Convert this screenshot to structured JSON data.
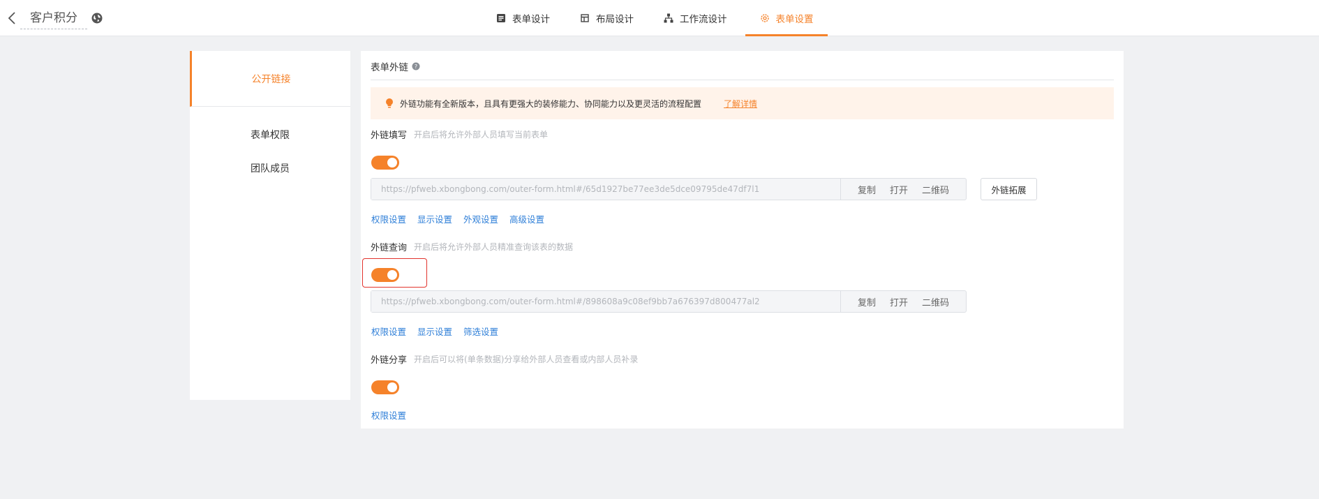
{
  "header": {
    "app_title": "客户积分",
    "tabs": [
      {
        "label": "表单设计",
        "icon": "form-icon",
        "active": false
      },
      {
        "label": "布局设计",
        "icon": "layout-icon",
        "active": false
      },
      {
        "label": "工作流设计",
        "icon": "workflow-icon",
        "active": false
      },
      {
        "label": "表单设置",
        "icon": "gear-icon",
        "active": true
      }
    ]
  },
  "sidebar": {
    "items": [
      {
        "label": "公开链接",
        "active": true
      },
      {
        "label": "表单权限",
        "active": false
      },
      {
        "label": "团队成员",
        "active": false
      }
    ]
  },
  "main": {
    "section_title": "表单外链",
    "notice": {
      "text": "外链功能有全新版本，且具有更强大的装修能力、协同能力以及更灵活的流程配置",
      "link": "了解详情"
    },
    "fill": {
      "label": "外链填写",
      "desc": "开启后将允许外部人员填写当前表单",
      "enabled": true,
      "url": "https://pfweb.xbongbong.com/outer-form.html#/65d1927be77ee3de5dce09795de47df7l1",
      "actions": [
        "复制",
        "打开",
        "二维码"
      ],
      "extend_button": "外链拓展",
      "links": [
        "权限设置",
        "显示设置",
        "外观设置",
        "高级设置"
      ]
    },
    "query": {
      "label": "外链查询",
      "desc": "开启后将允许外部人员精准查询该表的数据",
      "enabled": true,
      "url": "https://pfweb.xbongbong.com/outer-form.html#/898608a9c08ef9bb7a676397d800477al2",
      "actions": [
        "复制",
        "打开",
        "二维码"
      ],
      "links": [
        "权限设置",
        "显示设置",
        "筛选设置"
      ]
    },
    "share": {
      "label": "外链分享",
      "desc": "开启后可以将(单条数据)分享给外部人员查看或内部人员补录",
      "enabled": true,
      "links": [
        "权限设置"
      ]
    }
  },
  "colors": {
    "accent": "#f5822a",
    "link": "#2f7fd8",
    "notice_bg": "#fff3ea",
    "focus_border": "#e2332d"
  }
}
